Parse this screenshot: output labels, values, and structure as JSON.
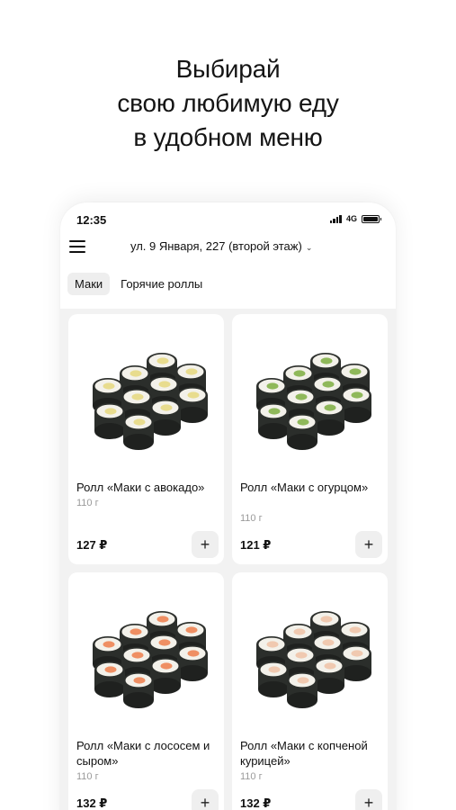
{
  "promo": {
    "line1": "Выбирай",
    "line2": "свою любимую еду",
    "line3": "в удобном меню"
  },
  "status_bar": {
    "time": "12:35",
    "network": "4G"
  },
  "header": {
    "address": "ул. 9 Января, 227 (второй этаж)",
    "chevron": "⌄"
  },
  "tabs": [
    {
      "label": "Маки",
      "active": true
    },
    {
      "label": "Горячие роллы",
      "active": false
    }
  ],
  "products": [
    {
      "title": "Ролл «Маки с авокадо»",
      "weight": "110 г",
      "price": "127 ₽",
      "filling": "avocado"
    },
    {
      "title": "Ролл «Маки с огурцом»",
      "weight": "110 г",
      "price": "121 ₽",
      "filling": "cucumber"
    },
    {
      "title": "Ролл «Маки с лососем и сыром»",
      "weight": "110 г",
      "price": "132 ₽",
      "filling": "salmon"
    },
    {
      "title": "Ролл «Маки с копченой курицей»",
      "weight": "110 г",
      "price": "132 ₽",
      "filling": "chicken"
    }
  ],
  "add_button": "+",
  "colors": {
    "nori": "#2b2e2b",
    "rice": "#f3f1ea",
    "avocado": "#e8dc8e",
    "cucumber": "#8fb85a",
    "salmon": "#ef8f63",
    "chicken": "#f0c9b0"
  },
  "icons": {
    "menu": "hamburger-icon",
    "add": "plus-icon",
    "signal": "signal-icon",
    "battery": "battery-icon"
  }
}
